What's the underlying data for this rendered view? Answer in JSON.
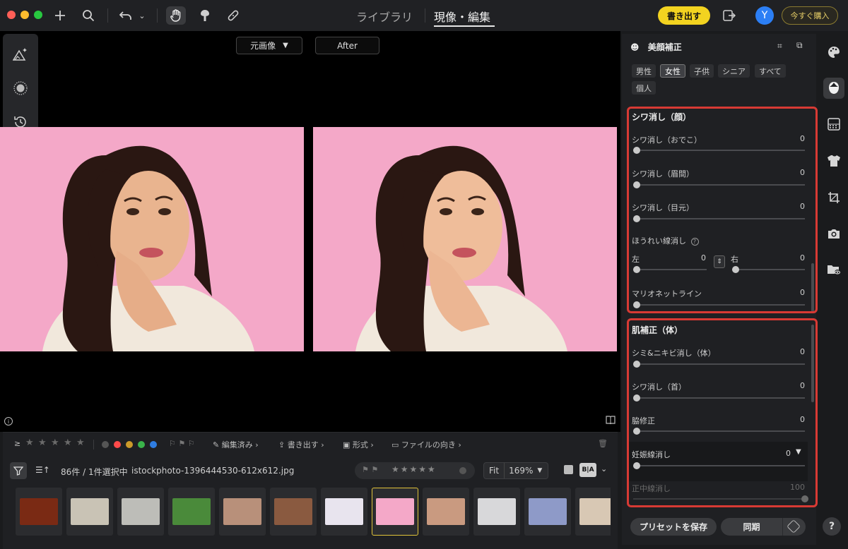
{
  "window": {
    "nav_tabs": [
      "ライブラリ",
      "現像・編集"
    ],
    "export_label": "書き出す",
    "avatar_initial": "Y",
    "buy_label": "今すぐ購入"
  },
  "viewer": {
    "compare_mode": "元画像",
    "after_label": "After"
  },
  "filmstrip": {
    "flags_label": "≥",
    "edited_label": "編集済み",
    "export_label": "書き出す",
    "format_label": "形式",
    "orientation_label": "ファイルの向き",
    "count_text": "86件 / 1件選択中",
    "filename": "istockphoto-1396444530-612x612.jpg",
    "fit_label": "Fit",
    "zoom_level": "169%",
    "compare_badge": "B|A",
    "color_labels": [
      "#ff4a4a",
      "#cc9a2a",
      "#3ab34a",
      "#2f7de1"
    ],
    "thumbnail_count": 12,
    "selected_index": 7
  },
  "panel": {
    "title": "美顔補正",
    "chips": [
      "男性",
      "女性",
      "子供",
      "シニア",
      "すべて",
      "個人"
    ],
    "active_chip": "女性",
    "face_section": {
      "title": "シワ消し（顔）",
      "forehead": {
        "label": "シワ消し（おでこ）",
        "value": "0"
      },
      "glabella": {
        "label": "シワ消し（眉間）",
        "value": "0"
      },
      "eyes": {
        "label": "シワ消し（目元）",
        "value": "0"
      },
      "nasolabial_title": "ほうれい線消し",
      "left_label": "左",
      "left_value": "0",
      "right_label": "右",
      "right_value": "0",
      "marionette": {
        "label": "マリオネットライン",
        "value": "0"
      }
    },
    "body_section": {
      "title": "肌補正（体）",
      "acne": {
        "label": "シミ&ニキビ消し（体）",
        "value": "0"
      },
      "neck": {
        "label": "シワ消し（首）",
        "value": "0"
      },
      "armpit": {
        "label": "脇修正",
        "value": "0"
      },
      "stretch": {
        "label": "妊娠線消し",
        "value": "0"
      },
      "midline": {
        "label": "正中線消し",
        "value": "100"
      }
    },
    "save_preset_label": "プリセットを保存",
    "sync_label": "同期"
  },
  "help_label": "?",
  "colors": {
    "accent_yellow": "#f3d320",
    "highlight_red": "#d83a34",
    "photo_background": "#f4a8c8"
  }
}
